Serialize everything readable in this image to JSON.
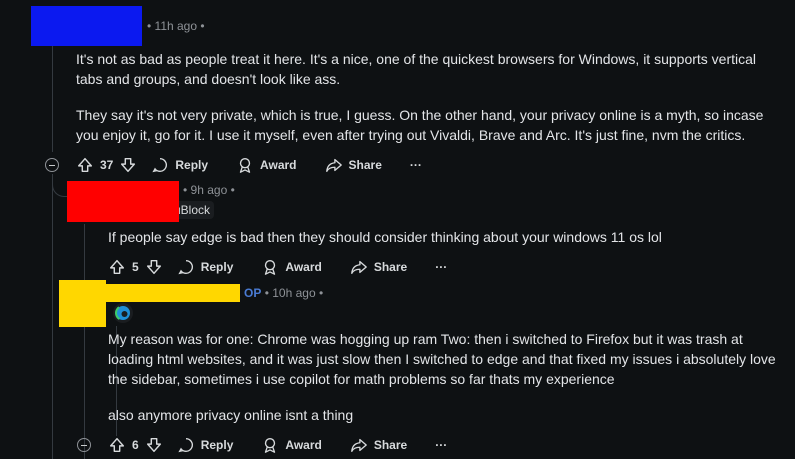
{
  "comments": [
    {
      "time": "11h ago",
      "paragraphs": [
        "It's not as bad as people treat it here. It's a nice, one of the quickest browsers for Windows, it supports vertical tabs and groups, and doesn't look like ass.",
        "They say it's not very private, which is true, I guess. On the other hand, your privacy online is a myth, so incase you enjoy it, go for it. I use it myself, even after trying out Vivaldi, Brave and Arc. It's just fine, nvm the critics."
      ],
      "score": "37",
      "colors": {
        "redaction": "#0b19f0"
      }
    },
    {
      "time": "9h ago",
      "flair": "uBlock",
      "paragraphs": [
        "If people say edge is bad then they should consider thinking about your windows 11 os lol"
      ],
      "score": "5",
      "colors": {
        "redaction": "#ff0000"
      }
    },
    {
      "op_label": "OP",
      "time": "10h ago",
      "flair_icon": "edge-browser-icon",
      "paragraphs": [
        "My reason was for one: Chrome was hogging up ram Two: then i switched to Firefox but it was trash at loading html websites, and it was just slow then I switched to edge and that fixed my issues i absolutely love the sidebar, sometimes i use copilot for math problems so far thats my experience",
        "also anymore privacy online isnt a thing"
      ],
      "score": "6",
      "colors": {
        "redaction": "#ffd700",
        "op": "#4a7bd3"
      }
    }
  ],
  "actions": {
    "reply": "Reply",
    "award": "Award",
    "share": "Share",
    "more": "···"
  },
  "separator": "•"
}
